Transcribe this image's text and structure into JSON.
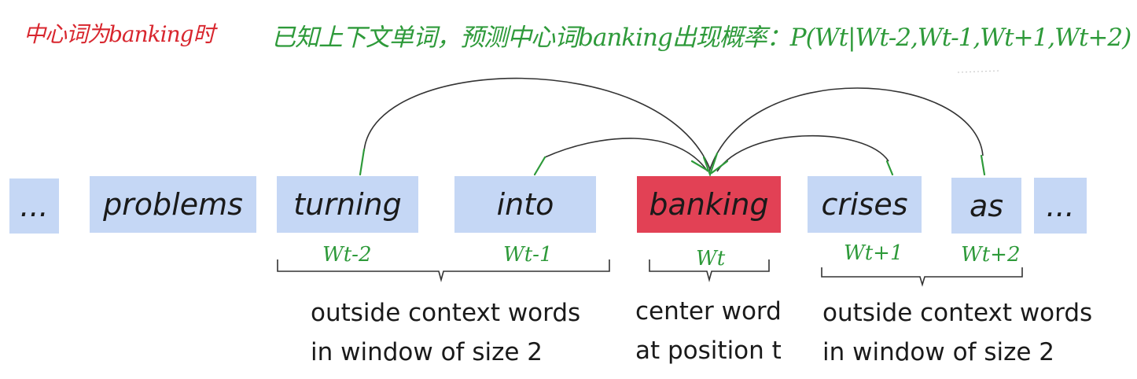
{
  "annotations": {
    "left_note": "中心词为banking时",
    "top_note": "已知上下文单词，预测中心词banking出现概率：P(Wt|Wt-2,Wt-1,Wt+1,Wt+2)"
  },
  "words": [
    {
      "text": "...",
      "role": "ellipsis"
    },
    {
      "text": "problems",
      "role": "other"
    },
    {
      "text": "turning",
      "role": "context"
    },
    {
      "text": "into",
      "role": "context"
    },
    {
      "text": "banking",
      "role": "center"
    },
    {
      "text": "crises",
      "role": "context"
    },
    {
      "text": "as",
      "role": "context"
    },
    {
      "text": "...",
      "role": "ellipsis"
    }
  ],
  "position_labels": {
    "t_minus_2": "Wt-2",
    "t_minus_1": "Wt-1",
    "t": "Wt",
    "t_plus_1": "Wt+1",
    "t_plus_2": "Wt+2"
  },
  "captions": {
    "left": {
      "line1": "outside context words",
      "line2": "in window of size 2"
    },
    "center": {
      "line1": "center word",
      "line2": "at position t"
    },
    "right": {
      "line1": "outside context words",
      "line2": "in window of size 2"
    }
  },
  "colors": {
    "context_box": "#c5d7f5",
    "center_box": "#e24155",
    "annotation_green": "#2e9a3a",
    "annotation_red": "#d8262e"
  }
}
